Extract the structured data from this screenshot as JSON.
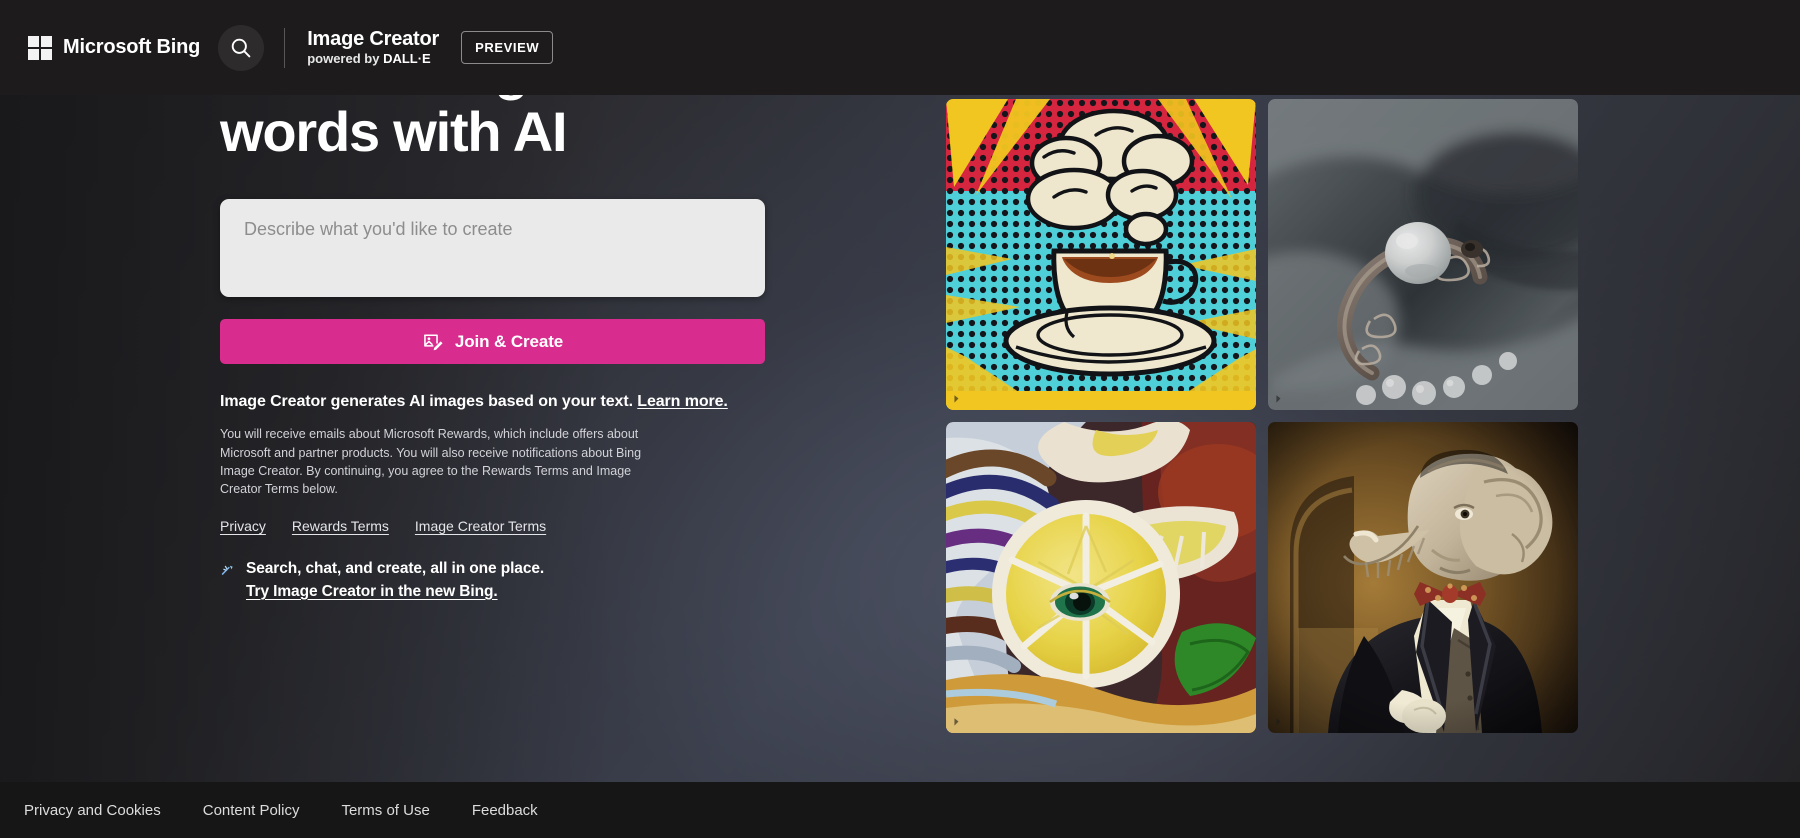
{
  "header": {
    "brand": "Microsoft Bing",
    "search_icon": "search-icon",
    "product_title": "Image Creator",
    "powered_prefix": "powered by ",
    "powered_brand": "DALL·E",
    "preview_badge": "PREVIEW"
  },
  "hero": {
    "title": "Create images from words with AI",
    "prompt_placeholder": "Describe what you'd like to create",
    "prompt_value": "",
    "cta_label": "Join & Create",
    "cta_icon": "image-edit-icon",
    "cta_color": "#d82c8f",
    "legal_headline": "Image Creator generates AI images based on your text.",
    "legal_headline_link": "Learn more.",
    "legal_body": "You will receive emails about Microsoft Rewards, which include offers about Microsoft and partner products. You will also receive notifications about Bing Image Creator. By continuing, you agree to the Rewards Terms and Image Creator Terms below.",
    "legal_links": [
      {
        "label": "Privacy"
      },
      {
        "label": "Rewards Terms"
      },
      {
        "label": "Image Creator Terms"
      }
    ],
    "new_bing_icon": "bing-chat-icon",
    "new_bing_line1": "Search, chat, and create, all in one place.",
    "new_bing_line2": "Try Image Creator in the new Bing."
  },
  "gallery": {
    "tiles": [
      {
        "name": "tile-popart-coffee",
        "alt": "Pop art comic style illustration of a steaming coffee cup on a saucer over a halftone dot background with red, yellow and cyan rays"
      },
      {
        "name": "tile-pearl-ring",
        "alt": "Close up photo of an ornate filigree silver ring with a white pearl resting on soft gray fabric with small pearls"
      },
      {
        "name": "tile-lemon-eye",
        "alt": "Surreal oil painting of a lemon slice with a green eye at its center surrounded by swirling colorful brushstrokes"
      },
      {
        "name": "tile-elephant-tuxedo",
        "alt": "Vintage style portrait painting of an elephant wearing a black tuxedo, waistcoat and red bow tie"
      }
    ]
  },
  "footer": {
    "links": [
      {
        "label": "Privacy and Cookies"
      },
      {
        "label": "Content Policy"
      },
      {
        "label": "Terms of Use"
      },
      {
        "label": "Feedback"
      }
    ]
  }
}
